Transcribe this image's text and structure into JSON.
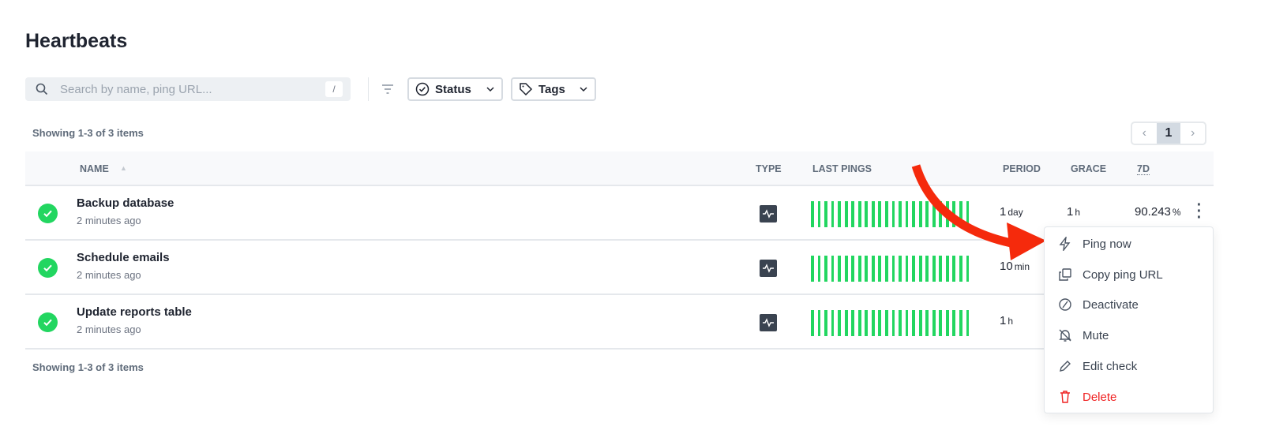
{
  "title": "Heartbeats",
  "search": {
    "placeholder": "Search by name, ping URL...",
    "shortcut": "/"
  },
  "filters": {
    "status": "Status",
    "tags": "Tags"
  },
  "showing": "Showing 1-3 of 3 items",
  "pager": {
    "current": "1"
  },
  "columns": {
    "name": "NAME",
    "type": "TYPE",
    "last_pings": "LAST PINGS",
    "period": "PERIOD",
    "grace": "GRACE",
    "uptime": "7D"
  },
  "rows": [
    {
      "name": "Backup database",
      "sub": "2 minutes ago",
      "status": "up",
      "period": "1",
      "period_unit": "day",
      "grace": "1",
      "grace_unit": "h",
      "uptime": "90.243",
      "uptime_unit": "%"
    },
    {
      "name": "Schedule emails",
      "sub": "2 minutes ago",
      "status": "up",
      "period": "10",
      "period_unit": "min"
    },
    {
      "name": "Update reports table",
      "sub": "2 minutes ago",
      "status": "up",
      "period": "1",
      "period_unit": "h"
    }
  ],
  "ping_bar_count": 24,
  "colors": {
    "success": "#22d660",
    "danger": "#ef2020",
    "arrow": "#f52a0c"
  },
  "menu": {
    "items": [
      "Ping now",
      "Copy ping URL",
      "Deactivate",
      "Mute",
      "Edit check"
    ],
    "delete": "Delete"
  }
}
